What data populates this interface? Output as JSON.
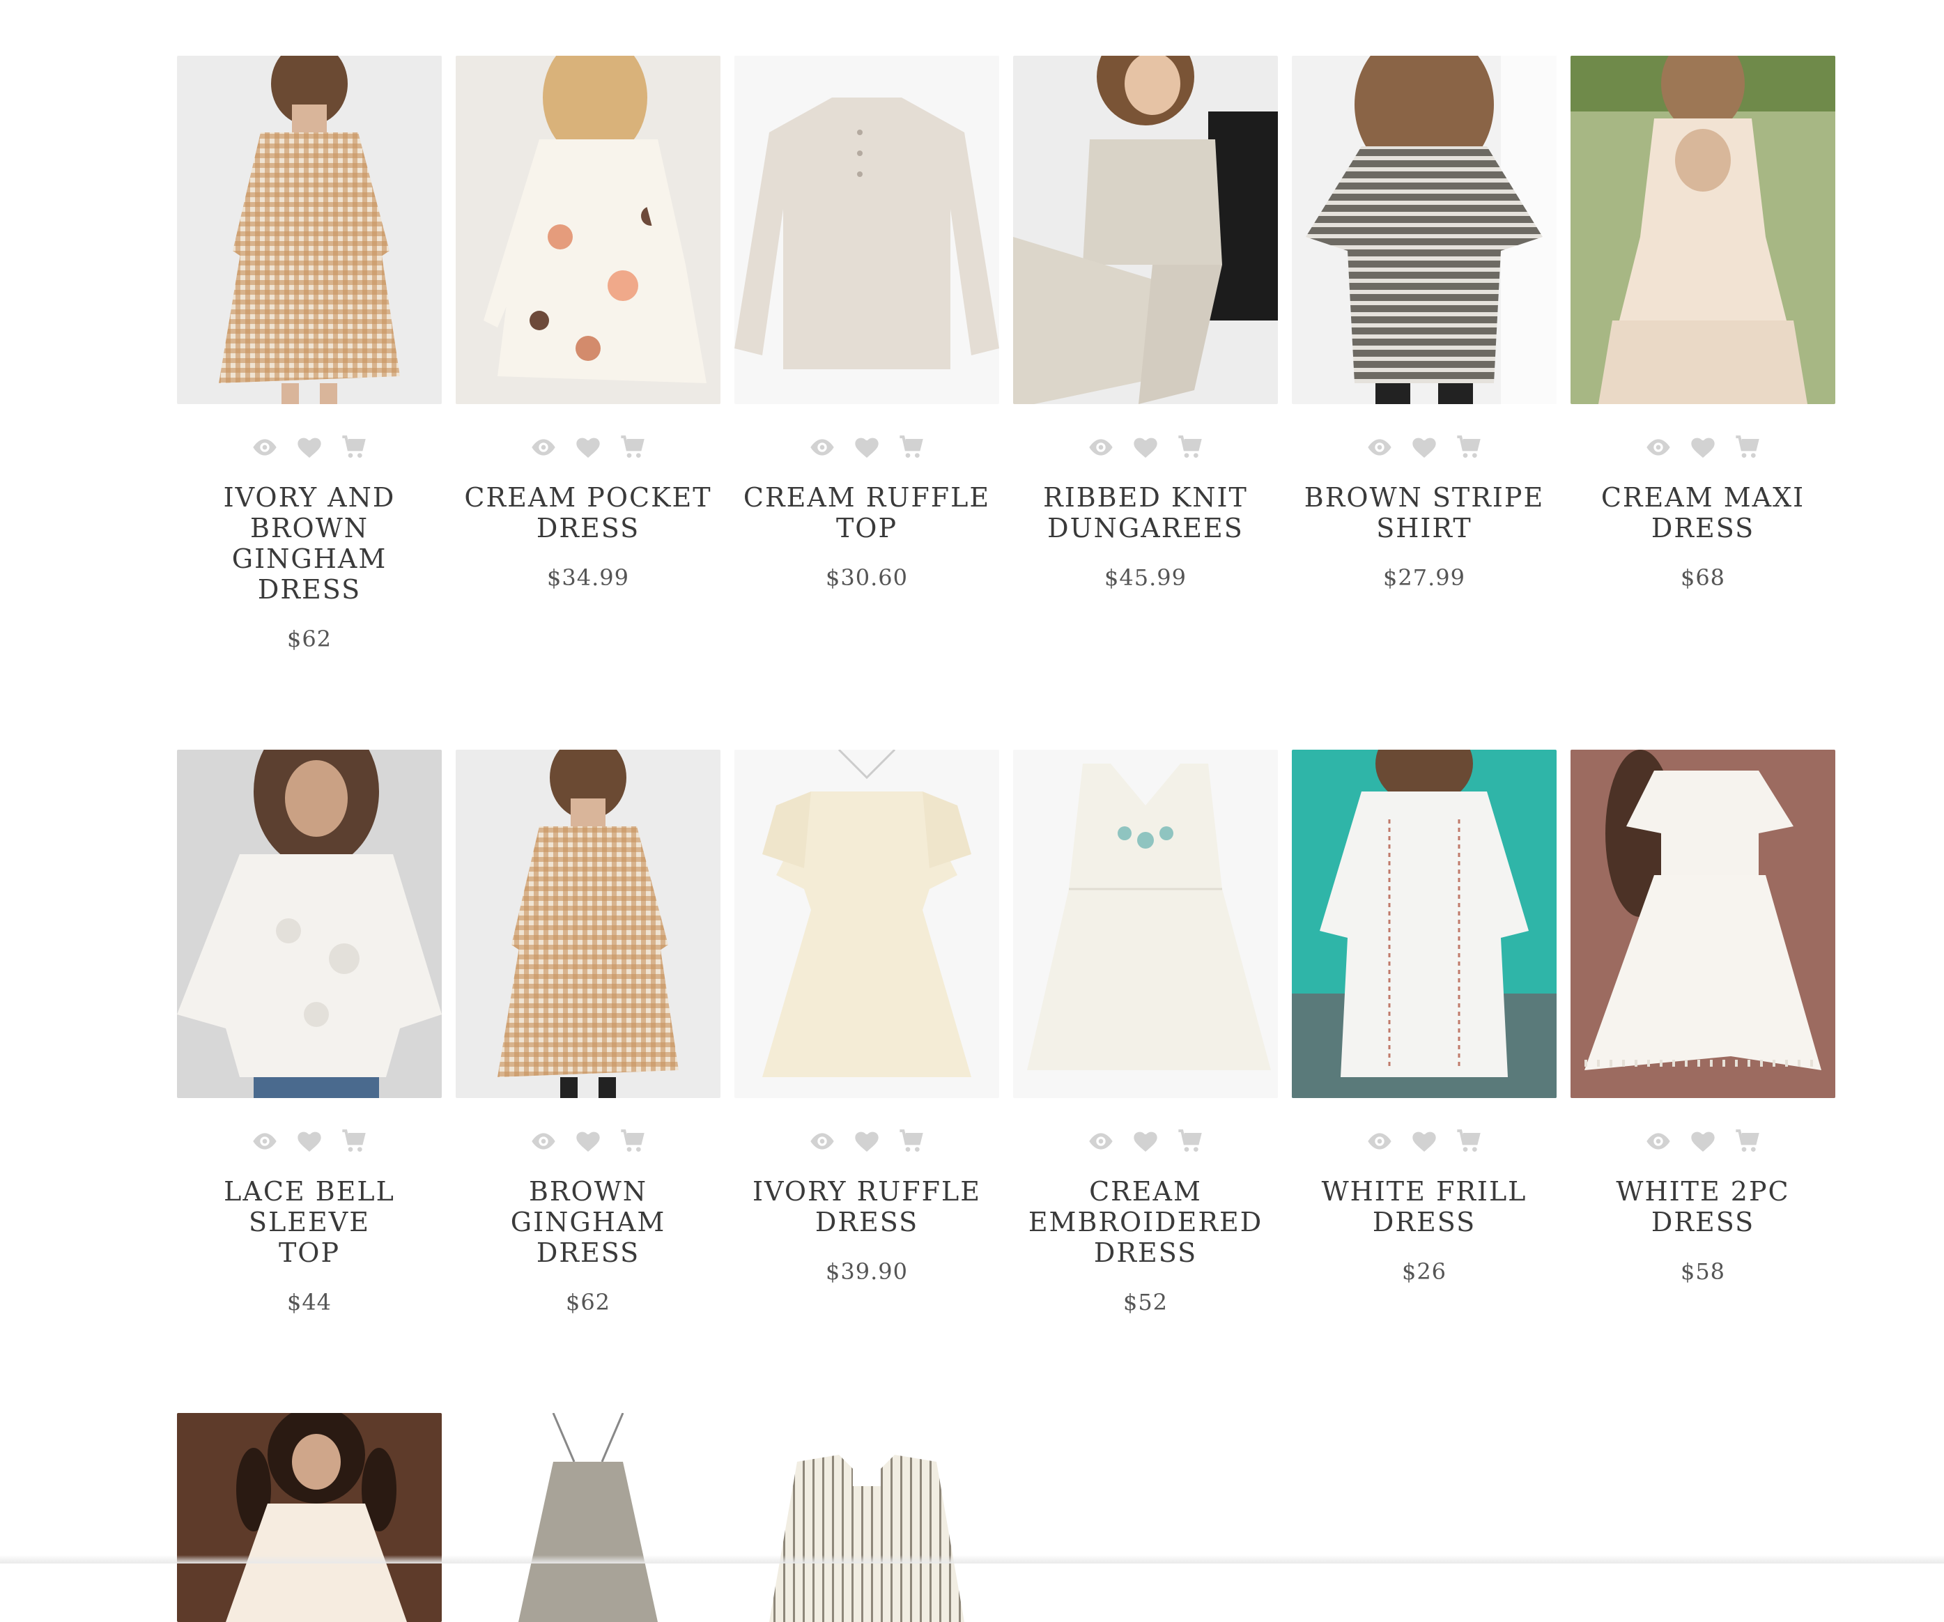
{
  "colors": {
    "icon": "#d2d2d2",
    "title": "#3a3a3a",
    "price": "#555555"
  },
  "action_icons": [
    "eye-icon",
    "heart-icon",
    "cart-icon"
  ],
  "products": [
    {
      "title": "IVORY AND BROWN\nGINGHAM DRESS",
      "price": "$62"
    },
    {
      "title": "CREAM POCKET\nDRESS",
      "price": "$34.99"
    },
    {
      "title": "CREAM RUFFLE TOP",
      "price": "$30.60"
    },
    {
      "title": "RIBBED KNIT\nDUNGAREES",
      "price": "$45.99"
    },
    {
      "title": "BROWN STRIPE\nSHIRT",
      "price": "$27.99"
    },
    {
      "title": "CREAM MAXI DRESS",
      "price": "$68"
    },
    {
      "title": "LACE BELL SLEEVE\nTOP",
      "price": "$44"
    },
    {
      "title": "BROWN GINGHAM\nDRESS",
      "price": "$62"
    },
    {
      "title": "IVORY RUFFLE\nDRESS",
      "price": "$39.90"
    },
    {
      "title": "CREAM\nEMBROIDERED\nDRESS",
      "price": "$52"
    },
    {
      "title": "WHITE FRILL DRESS",
      "price": "$26"
    },
    {
      "title": "WHITE 2PC DRESS",
      "price": "$58"
    }
  ]
}
